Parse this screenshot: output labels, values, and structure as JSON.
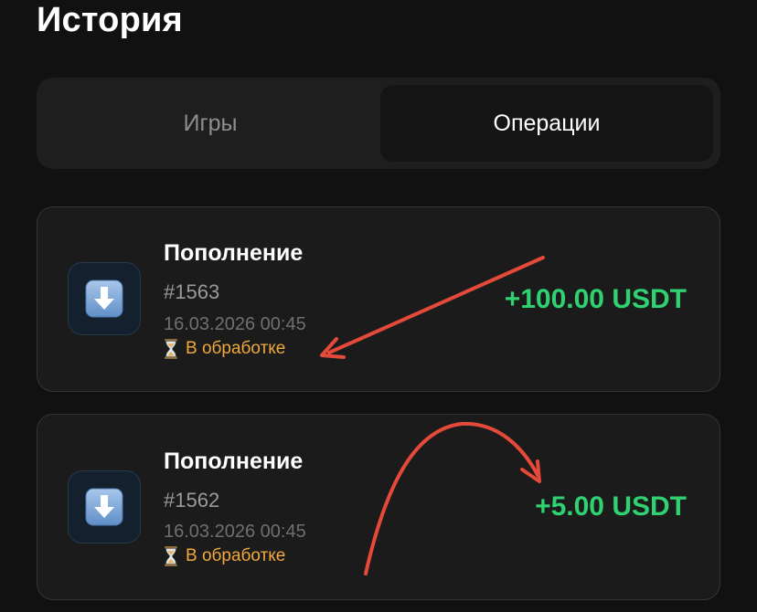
{
  "header": {
    "title": "История"
  },
  "tabs": [
    {
      "label": "Игры",
      "active": false
    },
    {
      "label": "Операции",
      "active": true
    }
  ],
  "transactions": [
    {
      "type": "Пополнение",
      "id": "#1563",
      "datetime": "16.03.2026 00:45",
      "status": "В обработке",
      "amount": "+100.00 USDT",
      "icon": "down-arrow-icon",
      "status_icon": "hourglass-icon"
    },
    {
      "type": "Пополнение",
      "id": "#1562",
      "datetime": "16.03.2026 00:45",
      "status": "В обработке",
      "amount": "+5.00 USDT",
      "icon": "down-arrow-icon",
      "status_icon": "hourglass-icon"
    }
  ],
  "colors": {
    "background": "#111111",
    "amount": "#2fd170",
    "status": "#f2a93b",
    "annotation": "#e5493a"
  }
}
